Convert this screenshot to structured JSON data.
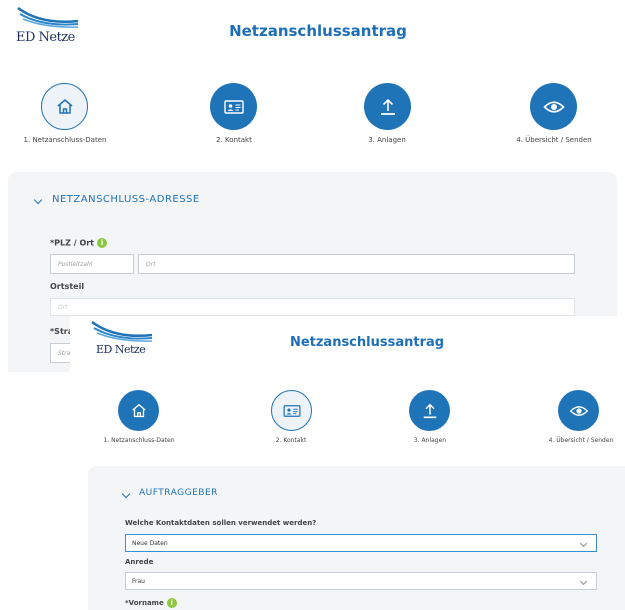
{
  "brand": {
    "name": "ED Netze",
    "color": "#1b2f5a",
    "accent": "#1f73b7",
    "info_color": "#8dc63f"
  },
  "page_title": "Netzanschlussantrag",
  "steps": [
    {
      "label": "1. Netzanschluss-Daten",
      "icon": "house-icon"
    },
    {
      "label": "2. Kontakt",
      "icon": "contact-card-icon"
    },
    {
      "label": "3. Anlagen",
      "icon": "upload-icon"
    },
    {
      "label": "4. Übersicht / Senden",
      "icon": "eye-icon"
    }
  ],
  "screen1": {
    "active_step": 1,
    "section_title": "NETZANSCHLUSS-ADRESSE",
    "plz_ort_label": "*PLZ / Ort",
    "plz_placeholder": "Postleitzahl",
    "ort_placeholder": "Ort",
    "ortsteil_label": "Ortsteil",
    "ortsteil_placeholder": "Ort",
    "strasse_label_partial": "*Stra",
    "strasse_placeholder_partial": "Stra"
  },
  "screen2": {
    "active_step": 2,
    "section_title": "AUFTRAGGEBER",
    "kontaktdaten_label": "Welche Kontaktdaten sollen verwendet werden?",
    "kontaktdaten_value": "Neue Daten",
    "anrede_label": "Anrede",
    "anrede_value": "Frau",
    "vorname_label": "*Vorname"
  },
  "info_glyph": "i"
}
